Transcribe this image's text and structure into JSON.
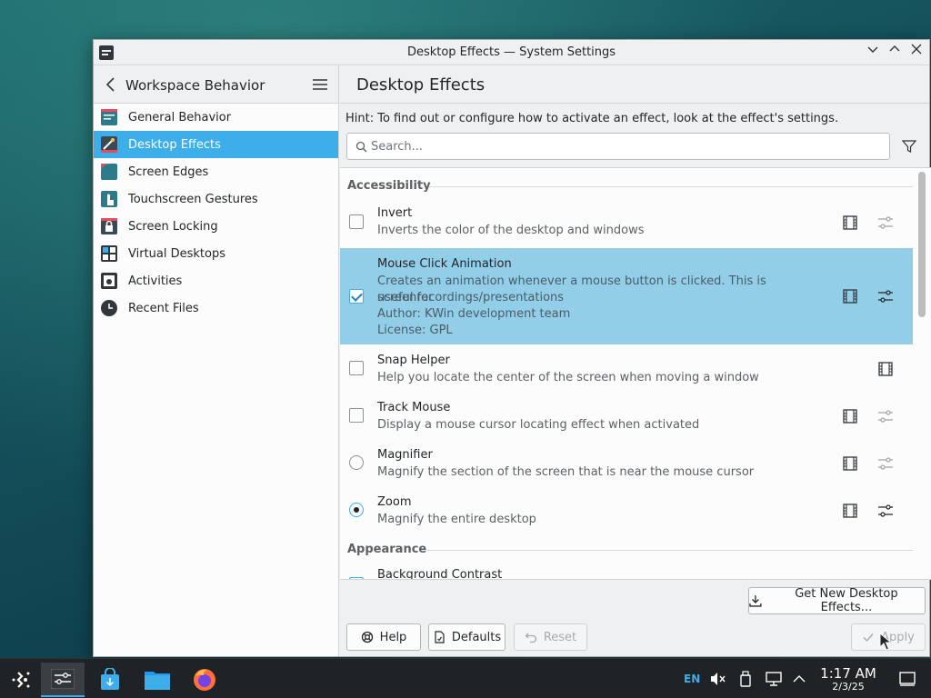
{
  "window": {
    "title": "Desktop Effects — System Settings",
    "minimize_glyph": "⌄",
    "maximize_glyph": "⌃",
    "close_glyph": "✕"
  },
  "sidebar": {
    "title": "Workspace Behavior",
    "items": [
      {
        "label": "General Behavior",
        "icon": "general-behavior-icon",
        "active": false
      },
      {
        "label": "Desktop Effects",
        "icon": "desktop-effects-icon",
        "active": true
      },
      {
        "label": "Screen Edges",
        "icon": "screen-edges-icon",
        "active": false
      },
      {
        "label": "Touchscreen Gestures",
        "icon": "touchscreen-gestures-icon",
        "active": false
      },
      {
        "label": "Screen Locking",
        "icon": "lock-icon",
        "active": false
      },
      {
        "label": "Virtual Desktops",
        "icon": "virtual-desktops-icon",
        "active": false
      },
      {
        "label": "Activities",
        "icon": "activities-icon",
        "active": false
      },
      {
        "label": "Recent Files",
        "icon": "clock-icon",
        "active": false
      }
    ]
  },
  "main": {
    "title": "Desktop Effects",
    "hint": "Hint: To find out or configure how to activate an effect, look at the effect's settings.",
    "search_placeholder": "Search...",
    "sections": [
      {
        "title": "Accessibility"
      },
      {
        "title": "Appearance"
      }
    ],
    "effects": [
      {
        "name": "Invert",
        "desc": [
          "Inverts the color of the desktop and windows"
        ],
        "control": "checkbox",
        "checked": false
      },
      {
        "name": "Mouse Click Animation",
        "desc": [
          "Creates an animation whenever a mouse button is clicked. This is useful for",
          "screenrecordings/presentations",
          "Author: KWin development team",
          "License: GPL"
        ],
        "control": "checkbox",
        "checked": true
      },
      {
        "name": "Snap Helper",
        "desc": [
          "Help you locate the center of the screen when moving a window"
        ],
        "control": "checkbox",
        "checked": false
      },
      {
        "name": "Track Mouse",
        "desc": [
          "Display a mouse cursor locating effect when activated"
        ],
        "control": "checkbox",
        "checked": false
      },
      {
        "name": "Magnifier",
        "desc": [
          "Magnify the section of the screen that is near the mouse cursor"
        ],
        "control": "radio",
        "checked": false
      },
      {
        "name": "Zoom",
        "desc": [
          "Magnify the entire desktop"
        ],
        "control": "radio",
        "checked": true
      },
      {
        "name": "Background Contrast",
        "desc": [],
        "control": "checkbox",
        "checked": false
      }
    ],
    "buttons": {
      "get_new": "Get New Desktop Effects...",
      "help": "Help",
      "defaults": "Defaults",
      "reset": "Reset",
      "apply": "Apply"
    }
  },
  "taskbar": {
    "lang": "EN",
    "time": "1:17 AM",
    "date": "2/3/25"
  },
  "colors": {
    "accent": "#3daee9",
    "selection": "#93cee9",
    "taskbar": "#202326"
  }
}
